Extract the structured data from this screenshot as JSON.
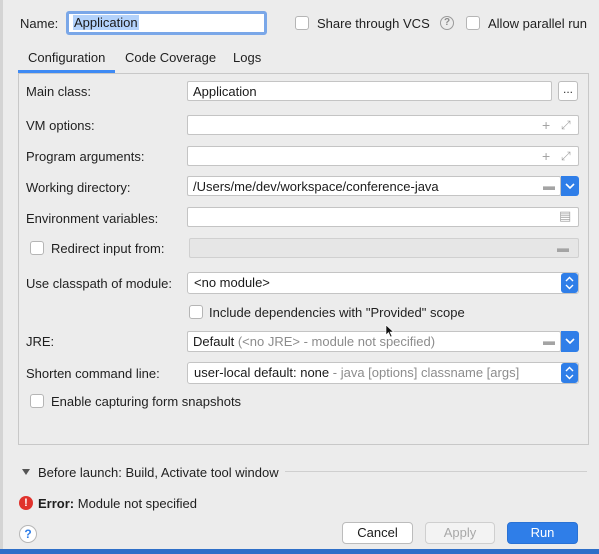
{
  "header": {
    "name_label": "Name:",
    "name_value": "Application",
    "share_label": "Share through VCS",
    "parallel_label": "Allow parallel run"
  },
  "tabs": [
    {
      "label": "Configuration"
    },
    {
      "label": "Code Coverage"
    },
    {
      "label": "Logs"
    }
  ],
  "form": {
    "main_class_label": "Main class:",
    "main_class_value": "Application",
    "browse_label": "...",
    "vm_options_label": "VM options:",
    "program_args_label": "Program arguments:",
    "working_dir_label": "Working directory:",
    "working_dir_value": "/Users/me/dev/workspace/conference-java",
    "env_vars_label": "Environment variables:",
    "redirect_label": "Redirect input from:",
    "classpath_label": "Use classpath of module:",
    "classpath_value": "<no module>",
    "include_deps_label": "Include dependencies with \"Provided\" scope",
    "jre_label": "JRE:",
    "jre_value_main": "Default",
    "jre_value_hint": "(<no JRE> - module not specified)",
    "shorten_label": "Shorten command line:",
    "shorten_value_main": "user-local default: none",
    "shorten_value_hint": "- java [options] classname [args]",
    "snapshots_label": "Enable capturing form snapshots"
  },
  "before_launch": {
    "label": "Before launch: Build, Activate tool window"
  },
  "error": {
    "prefix": "Error:",
    "message": "Module not specified"
  },
  "buttons": {
    "cancel": "Cancel",
    "apply": "Apply",
    "run": "Run",
    "help": "?"
  },
  "colors": {
    "accent": "#2f7ee8",
    "error": "#e0322c"
  }
}
